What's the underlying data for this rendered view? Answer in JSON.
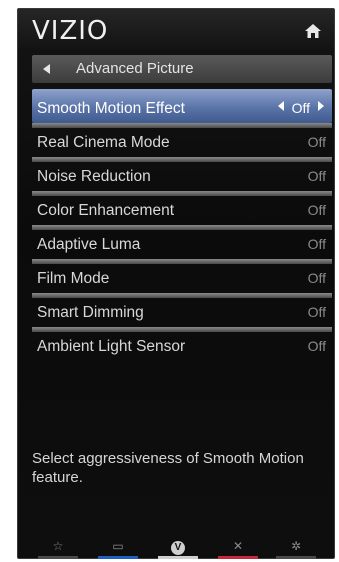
{
  "header": {
    "logo": "VIZIO",
    "home_icon": "home-icon"
  },
  "breadcrumb": {
    "label": "Advanced Picture",
    "back_icon": "back-arrow-icon"
  },
  "menu": {
    "items": [
      {
        "label": "Smooth Motion Effect",
        "value": "Off",
        "selected": true
      },
      {
        "label": "Real Cinema Mode",
        "value": "Off"
      },
      {
        "label": "Noise Reduction",
        "value": "Off"
      },
      {
        "label": "Color Enhancement",
        "value": "Off"
      },
      {
        "label": "Adaptive Luma",
        "value": "Off"
      },
      {
        "label": "Film Mode",
        "value": "Off"
      },
      {
        "label": "Smart Dimming",
        "value": "Off"
      },
      {
        "label": "Ambient Light Sensor",
        "value": "Off"
      }
    ]
  },
  "help_text": "Select aggressiveness of Smooth Motion feature.",
  "footer": {
    "buttons": [
      {
        "icon": "star-icon",
        "glyph": "☆",
        "color": "#4a4a4a"
      },
      {
        "icon": "input-icon",
        "glyph": "▭",
        "color": "#1f5fbf"
      },
      {
        "icon": "vizio-v-icon",
        "glyph": "V",
        "color": "#cfcfcf"
      },
      {
        "icon": "close-icon",
        "glyph": "✕",
        "color": "#c8283c"
      },
      {
        "icon": "gear-icon",
        "glyph": "✲",
        "color": "#4a4a4a"
      }
    ]
  },
  "colors": {
    "selected_row": "#5a74a8",
    "panel_bg": "#0b0b0b"
  }
}
